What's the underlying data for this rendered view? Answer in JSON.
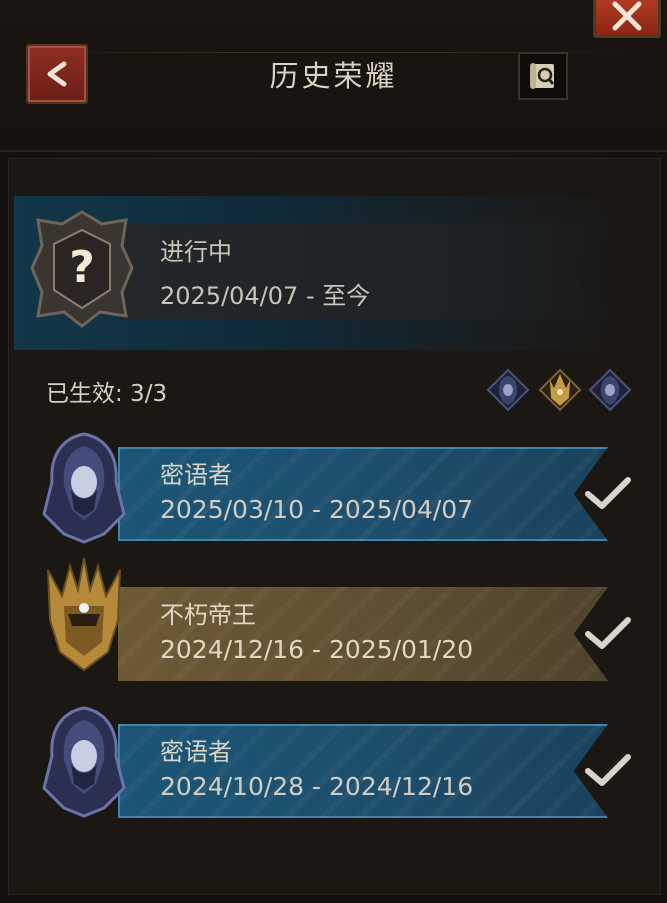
{
  "header": {
    "title": "历史荣耀",
    "back_icon": "chevron-left-icon",
    "close_icon": "close-x-icon",
    "scroll_icon": "scroll-search-icon"
  },
  "current": {
    "status": "进行中",
    "date_range": "2025/04/07 - 至今",
    "icon": "question-mark-emblem-icon"
  },
  "summary": {
    "label": "已生效: 3/3",
    "icons": [
      "whisperer-mini-icon",
      "emperor-mini-icon",
      "whisperer-mini-icon"
    ]
  },
  "records": [
    {
      "name": "密语者",
      "date_range": "2025/03/10 - 2025/04/07",
      "tier": "blue",
      "icon": "hooded-whisperer-icon",
      "checked": true
    },
    {
      "name": "不朽帝王",
      "date_range": "2024/12/16 - 2025/01/20",
      "tier": "gold",
      "icon": "golden-emperor-icon",
      "checked": true
    },
    {
      "name": "密语者",
      "date_range": "2024/10/28 - 2024/12/16",
      "tier": "blue",
      "icon": "hooded-whisperer-icon",
      "checked": true
    }
  ],
  "colors": {
    "blue_band": "#1c5576",
    "gold_band": "#6d5a35",
    "close_red": "#c4432a",
    "back_red": "#8f2e23"
  }
}
